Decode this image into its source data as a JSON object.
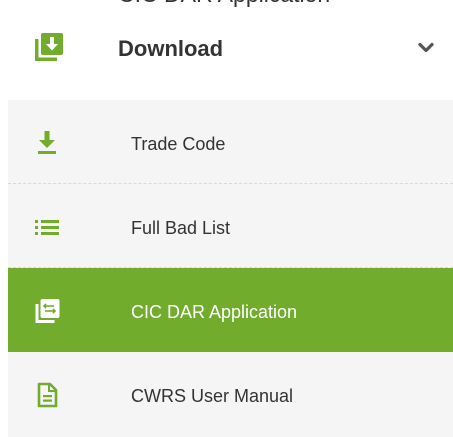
{
  "partial_header": {
    "title_fragment": "CIC DAR Application"
  },
  "section": {
    "label": "Download",
    "icon": "download-box-icon",
    "expanded": true
  },
  "menu": {
    "items": [
      {
        "label": "Trade Code",
        "icon": "download-arrow-icon",
        "active": false
      },
      {
        "label": "Full Bad List",
        "icon": "list-icon",
        "active": false
      },
      {
        "label": "CIC DAR Application",
        "icon": "transfer-window-icon",
        "active": true
      },
      {
        "label": "CWRS User Manual",
        "icon": "document-icon",
        "active": false
      }
    ]
  },
  "colors": {
    "accent": "#71ac2c",
    "submenu_bg": "#f5f5f5",
    "text": "#333333",
    "active_text": "#ffffff"
  }
}
